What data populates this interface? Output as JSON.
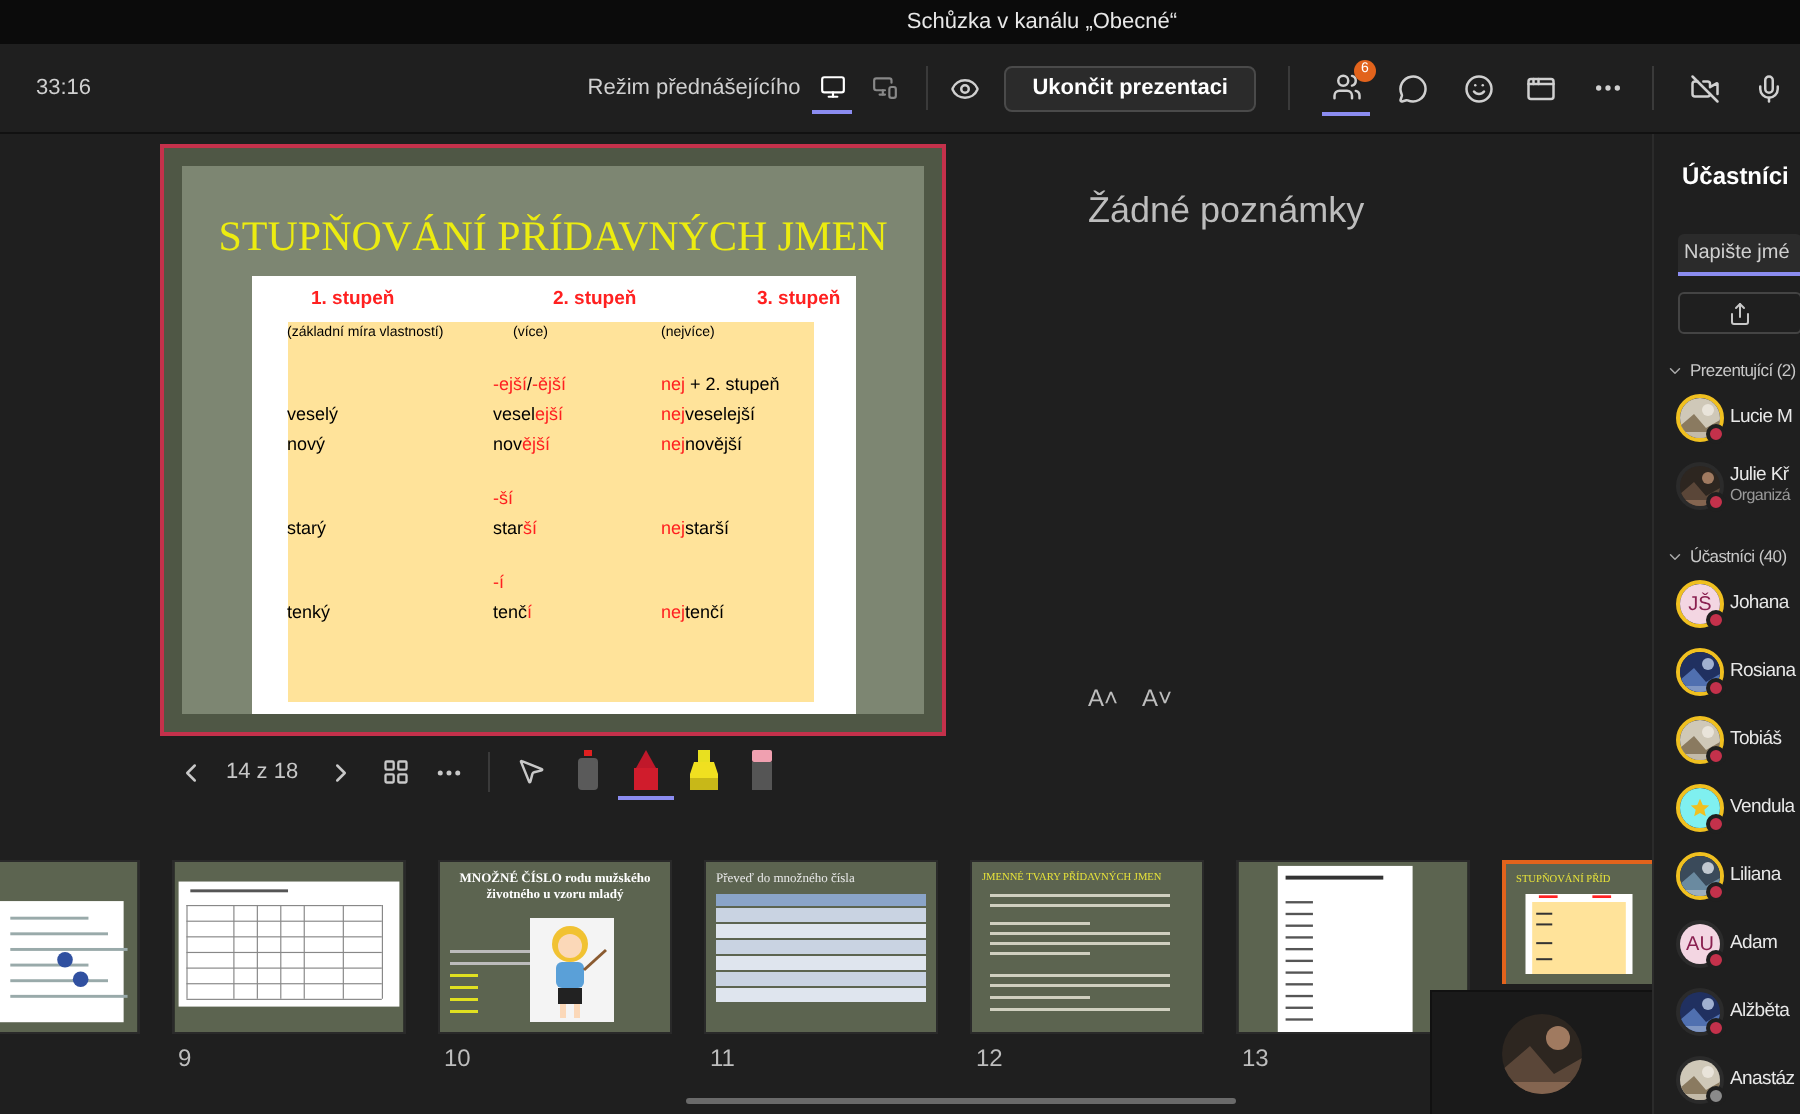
{
  "window": {
    "title": "Schůzka v kanálu „Obecné“"
  },
  "toolbar": {
    "timer": "33:16",
    "mode_label": "Režim přednášejícího",
    "modes": [
      {
        "selected": true
      },
      {
        "selected": false
      }
    ],
    "end_button": "Ukončit prezentaci",
    "participants_badge": "6",
    "participants_selected": true
  },
  "slide": {
    "title": "STUPŇOVÁNÍ PŘÍDAVNÝCH JMEN",
    "headers": [
      "1. stupeň",
      "2. stupeň",
      "3. stupeň"
    ],
    "groups": [
      {
        "rows": [
          {
            "cells": [
              [
                {
                  "text": "(základní míra vlastností)",
                  "red": false
                }
              ],
              [
                {
                  "text": "(více)",
                  "red": false
                }
              ],
              [
                {
                  "text": "(nejvíce)",
                  "red": false
                }
              ]
            ],
            "kind": "note"
          }
        ]
      },
      {
        "rows": [
          {
            "cells": [
              null,
              [
                {
                  "text": "-ejší",
                  "red": true
                },
                {
                  "text": "/",
                  "red": false
                },
                {
                  "text": "-ější",
                  "red": true
                }
              ],
              [
                {
                  "text": "nej",
                  "red": true
                },
                {
                  "text": " + 2. stupeň",
                  "red": false
                }
              ]
            ],
            "kind": "word"
          },
          {
            "cells": [
              [
                {
                  "text": "veselý",
                  "red": false
                }
              ],
              [
                {
                  "text": "vesel",
                  "red": false
                },
                {
                  "text": "ejší",
                  "red": true
                }
              ],
              [
                {
                  "text": "nej",
                  "red": true
                },
                {
                  "text": "veselejší",
                  "red": false
                }
              ]
            ],
            "kind": "word"
          },
          {
            "cells": [
              [
                {
                  "text": "nový",
                  "red": false
                }
              ],
              [
                {
                  "text": "nov",
                  "red": false
                },
                {
                  "text": "ější",
                  "red": true
                }
              ],
              [
                {
                  "text": "nej",
                  "red": true
                },
                {
                  "text": "novější",
                  "red": false
                }
              ]
            ],
            "kind": "word"
          }
        ]
      },
      {
        "rows": [
          {
            "cells": [
              null,
              [
                {
                  "text": "-ší",
                  "red": true
                }
              ],
              null
            ],
            "kind": "word"
          },
          {
            "cells": [
              [
                {
                  "text": "starý",
                  "red": false
                }
              ],
              [
                {
                  "text": "star",
                  "red": false
                },
                {
                  "text": "ší",
                  "red": true
                }
              ],
              [
                {
                  "text": "nej",
                  "red": true
                },
                {
                  "text": "starší",
                  "red": false
                }
              ]
            ],
            "kind": "word"
          }
        ]
      },
      {
        "rows": [
          {
            "cells": [
              null,
              [
                {
                  "text": "-í",
                  "red": true
                }
              ],
              null
            ],
            "kind": "word"
          },
          {
            "cells": [
              [
                {
                  "text": "tenký",
                  "red": false
                }
              ],
              [
                {
                  "text": "tenč",
                  "red": false
                },
                {
                  "text": "í",
                  "red": true
                }
              ],
              [
                {
                  "text": "nej",
                  "red": true
                },
                {
                  "text": "tenčí",
                  "red": false
                }
              ]
            ],
            "kind": "word"
          }
        ]
      }
    ]
  },
  "notes": "Žádné poznámky",
  "font_buttons": [
    "A˄",
    "A˅"
  ],
  "slide_controls": {
    "counter": "14 z 18"
  },
  "tools": [
    {
      "kind": "pointer",
      "selected": false
    },
    {
      "kind": "laser",
      "selected": false
    },
    {
      "kind": "pen",
      "selected": true
    },
    {
      "kind": "highlighter",
      "selected": false
    },
    {
      "kind": "eraser",
      "selected": false
    }
  ],
  "thumbnails": [
    {
      "kind": "worksheet",
      "selected": false
    },
    {
      "number": "9",
      "kind": "table",
      "selected": false
    },
    {
      "number": "10",
      "kind": "cartoon",
      "title": "MNOŽNÉ ČÍSLO rodu mužského životného u vzoru mladý",
      "selected": false
    },
    {
      "number": "11",
      "kind": "list-table",
      "title": "Převeď do množného čísla",
      "selected": false
    },
    {
      "number": "12",
      "kind": "bullets",
      "title": "JMENNÉ TVARY PŘÍDAVNÝCH JMEN",
      "selected": false
    },
    {
      "number": "13",
      "kind": "page",
      "selected": false
    },
    {
      "kind": "current",
      "title": "STUPŇOVÁNÍ PŘÍD",
      "selected": true
    }
  ],
  "panel": {
    "title": "Účastníci",
    "search": {
      "placeholder": "Napište jmé"
    },
    "sections": [
      {
        "label": "Prezentující (2)",
        "expanded": true,
        "people": [
          {
            "name": "Lucie M",
            "ring": true,
            "color": "#c4314b"
          },
          {
            "name": "Julie Kř",
            "role": "Organizá",
            "ring": false,
            "color": "#c4314b"
          }
        ]
      },
      {
        "label": "Účastníci (40)",
        "expanded": true,
        "people": [
          {
            "name": "Johana",
            "kind": "initials",
            "initials": "JŠ",
            "ring": true,
            "color": "#c4314b"
          },
          {
            "name": "Rosiana",
            "ring": true,
            "color": "#c4314b"
          },
          {
            "name": "Tobiáš",
            "ring": true,
            "color": "#c4314b"
          },
          {
            "name": "Vendula",
            "kind": "star",
            "ring": true,
            "color": "#c4314b"
          },
          {
            "name": "Liliana",
            "ring": true,
            "color": "#c4314b"
          },
          {
            "name": "Adam",
            "kind": "initials",
            "initials": "AU",
            "ring": false,
            "color": "#c4314b"
          },
          {
            "name": "Alžběta",
            "ring": false,
            "color": "#c4314b"
          },
          {
            "name": "Anastáz",
            "ring": false,
            "color": "#8a8a8a"
          }
        ]
      }
    ]
  }
}
